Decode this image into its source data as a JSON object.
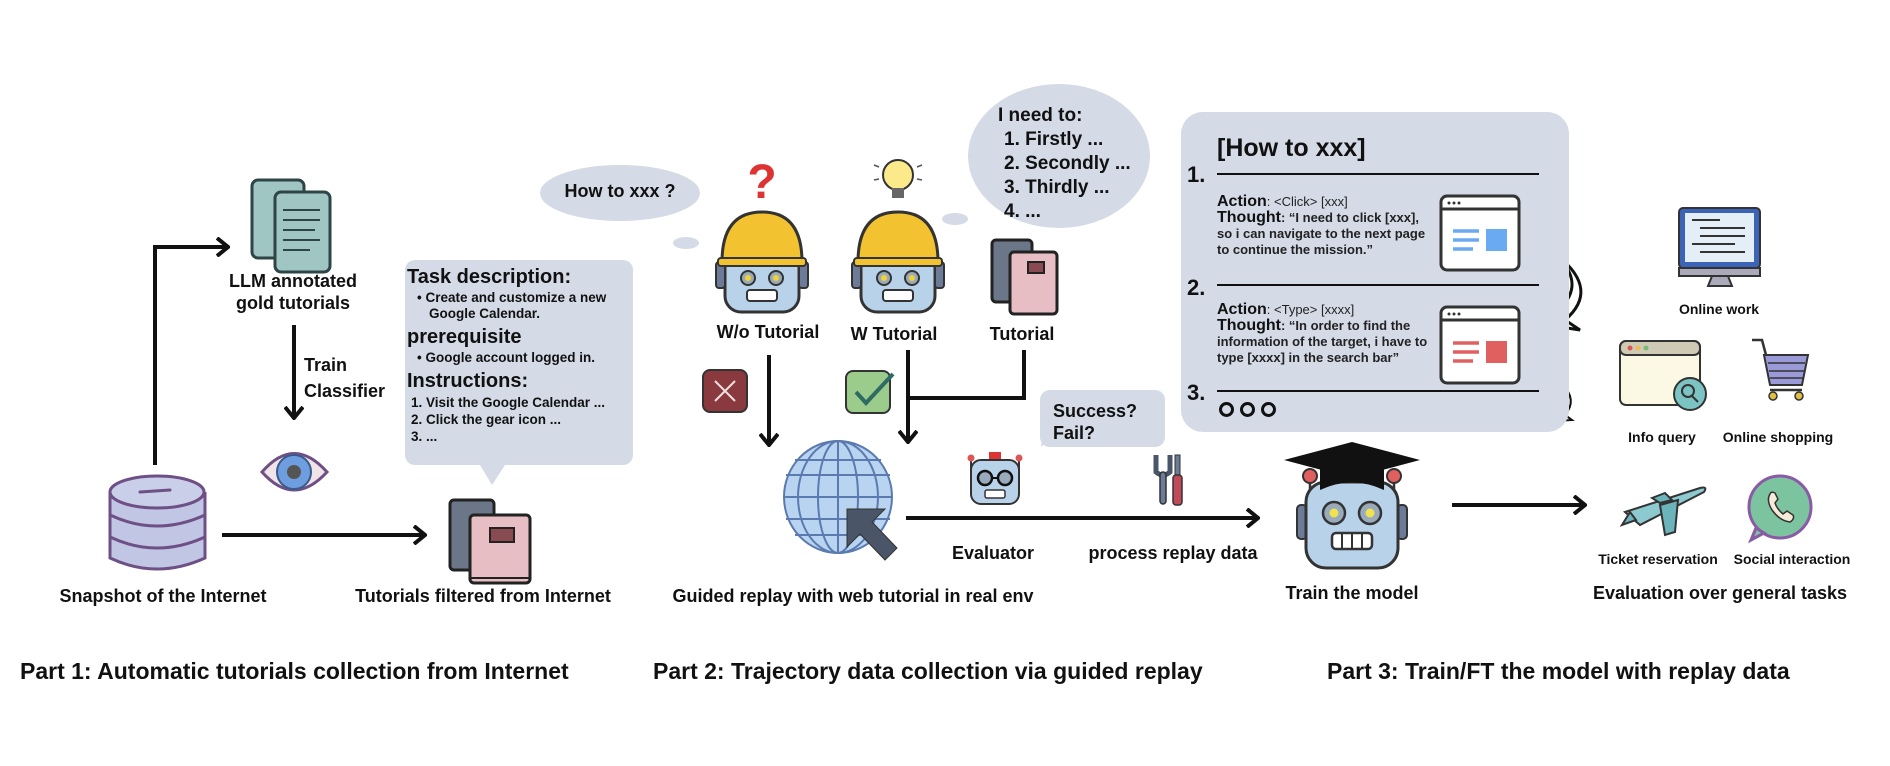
{
  "part1": {
    "title": "Part 1: Automatic tutorials collection from Internet",
    "snapshot_label": "Snapshot of the Internet",
    "gold_label_line1": "LLM annotated",
    "gold_label_line2": "gold tutorials",
    "classifier_label_line1": "Train",
    "classifier_label_line2": "Classifier",
    "filtered_label": "Tutorials filtered from Internet",
    "task_box": {
      "task_heading": "Task description:",
      "task_item": "Create and customize a new Google Calendar.",
      "prereq_heading": "prerequisite",
      "prereq_item": "Google account logged in.",
      "instr_heading": "Instructions:",
      "instructions": [
        "1. Visit the Google Calendar ...",
        "2. Click the gear icon ...",
        "3. ..."
      ]
    }
  },
  "part2": {
    "title": "Part 2: Trajectory data collection via guided replay",
    "thought_without": "How to xxx ?",
    "thought_with": {
      "heading": "I need to:",
      "steps": [
        "1. Firstly ...",
        "2. Secondly ...",
        "3. Thirdly ...",
        "4. ..."
      ]
    },
    "wo_tutorial_label": "W/o Tutorial",
    "w_tutorial_label": "W Tutorial",
    "tutorial_label": "Tutorial",
    "replay_label": "Guided replay with web tutorial in real env",
    "evaluator_question_line1": "Success?",
    "evaluator_question_line2": "Fail?",
    "evaluator_label": "Evaluator",
    "process_label": "process replay data"
  },
  "part3": {
    "title": "Part 3: Train/FT the model with replay data",
    "tutorial_panel": {
      "title": "[How to xxx]",
      "steps": [
        {
          "number": "1.",
          "action_key": "Action",
          "action_value": ": <Click> [xxx]",
          "thought_key": "Thought",
          "thought_value": ": “I need to click [xxx], so i can navigate to the next page to continue the mission.”",
          "accent": "#6aaaf2"
        },
        {
          "number": "2.",
          "action_key": "Action",
          "action_value": ": <Type> [xxxx]",
          "thought_key": "Thought",
          "thought_value": ": “In order to find the information of the target, i have to type [xxxx] in the search bar”",
          "accent": "#e06060"
        },
        {
          "number": "3."
        }
      ]
    },
    "train_label": "Train the model",
    "eval_label": "Evaluation over general tasks",
    "tasks": {
      "online_work": "Online work",
      "info_query": "Info query",
      "online_shopping": "Online shopping",
      "ticket_reservation": "Ticket reservation",
      "social_interaction": "Social interaction"
    }
  },
  "colors": {
    "bubble": "#d4dae6",
    "robot_face": "#b8d2ea",
    "helmet": "#f2c230",
    "fail": "#8a3a3f",
    "success": "#9ccc8c",
    "globe": "#b8d4f0",
    "database": "#c0c6e4"
  }
}
